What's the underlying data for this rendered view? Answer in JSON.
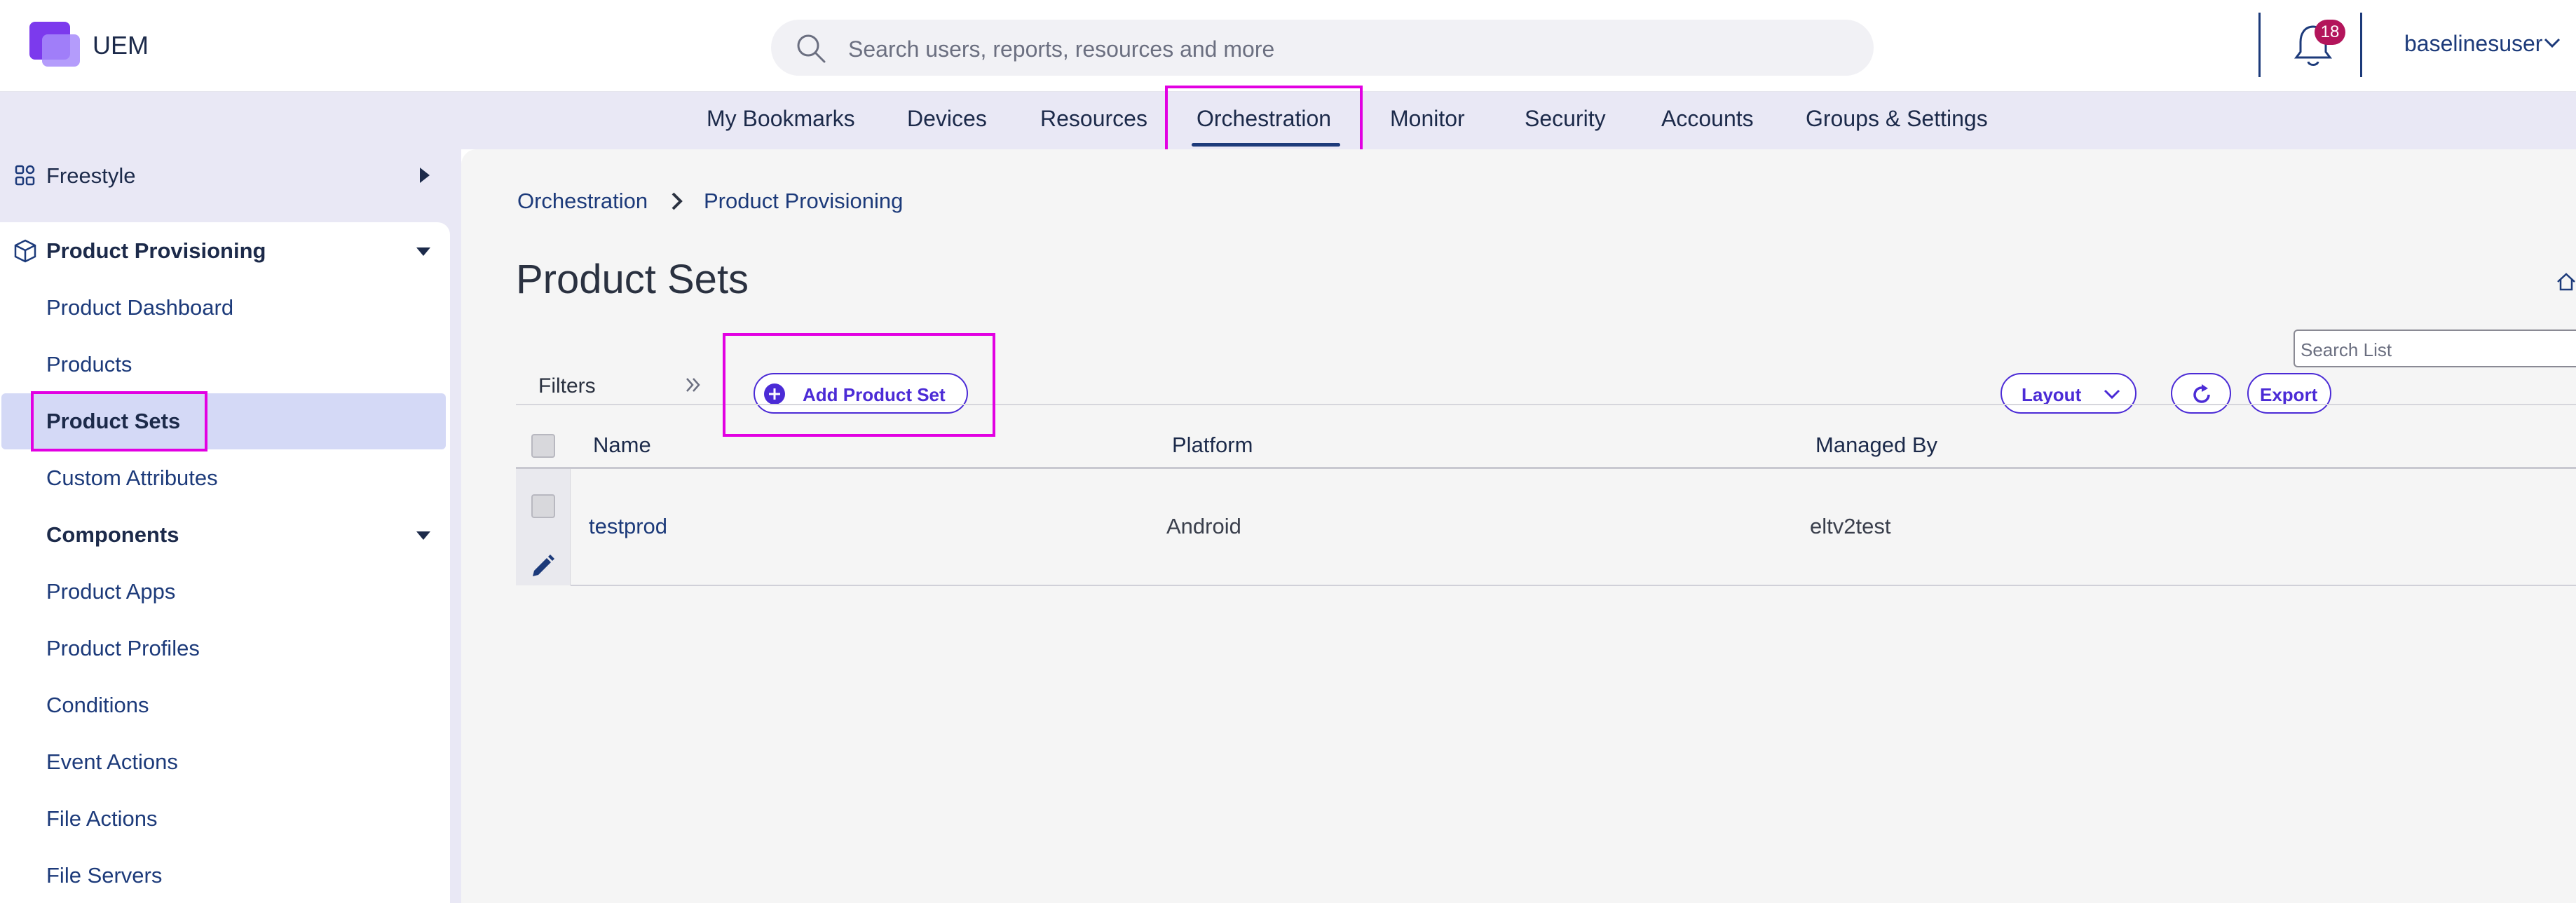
{
  "header": {
    "app_name": "UEM",
    "search_placeholder": "Search users, reports, resources and more",
    "notification_count": "18",
    "username": "baselinesuser"
  },
  "nav": {
    "items": [
      "My Bookmarks",
      "Devices",
      "Resources",
      "Orchestration",
      "Monitor",
      "Security",
      "Accounts",
      "Groups & Settings"
    ],
    "active": "Orchestration"
  },
  "sidebar": {
    "freestyle": "Freestyle",
    "section": "Product Provisioning",
    "items": [
      "Product Dashboard",
      "Products",
      "Product Sets",
      "Custom Attributes"
    ],
    "components": "Components",
    "component_items": [
      "Product Apps",
      "Product Profiles",
      "Conditions",
      "Event Actions",
      "File Actions",
      "File Servers"
    ],
    "selected": "Product Sets"
  },
  "breadcrumb": {
    "parent": "Orchestration",
    "current": "Product Provisioning"
  },
  "page": {
    "title": "Product Sets"
  },
  "toolbar": {
    "filters_label": "Filters",
    "add_label": "Add Product Set",
    "layout_label": "Layout",
    "export_label": "Export",
    "search_placeholder": "Search List"
  },
  "table": {
    "columns": [
      "Name",
      "Platform",
      "Managed By"
    ],
    "rows": [
      {
        "name": "testprod",
        "platform": "Android",
        "managed_by": "eltv2test"
      }
    ]
  },
  "colors": {
    "accent": "#4b2bd6",
    "highlight": "#e200e2",
    "nav_bg": "#e9e8f5",
    "selected_bg": "#d4d9f6"
  }
}
